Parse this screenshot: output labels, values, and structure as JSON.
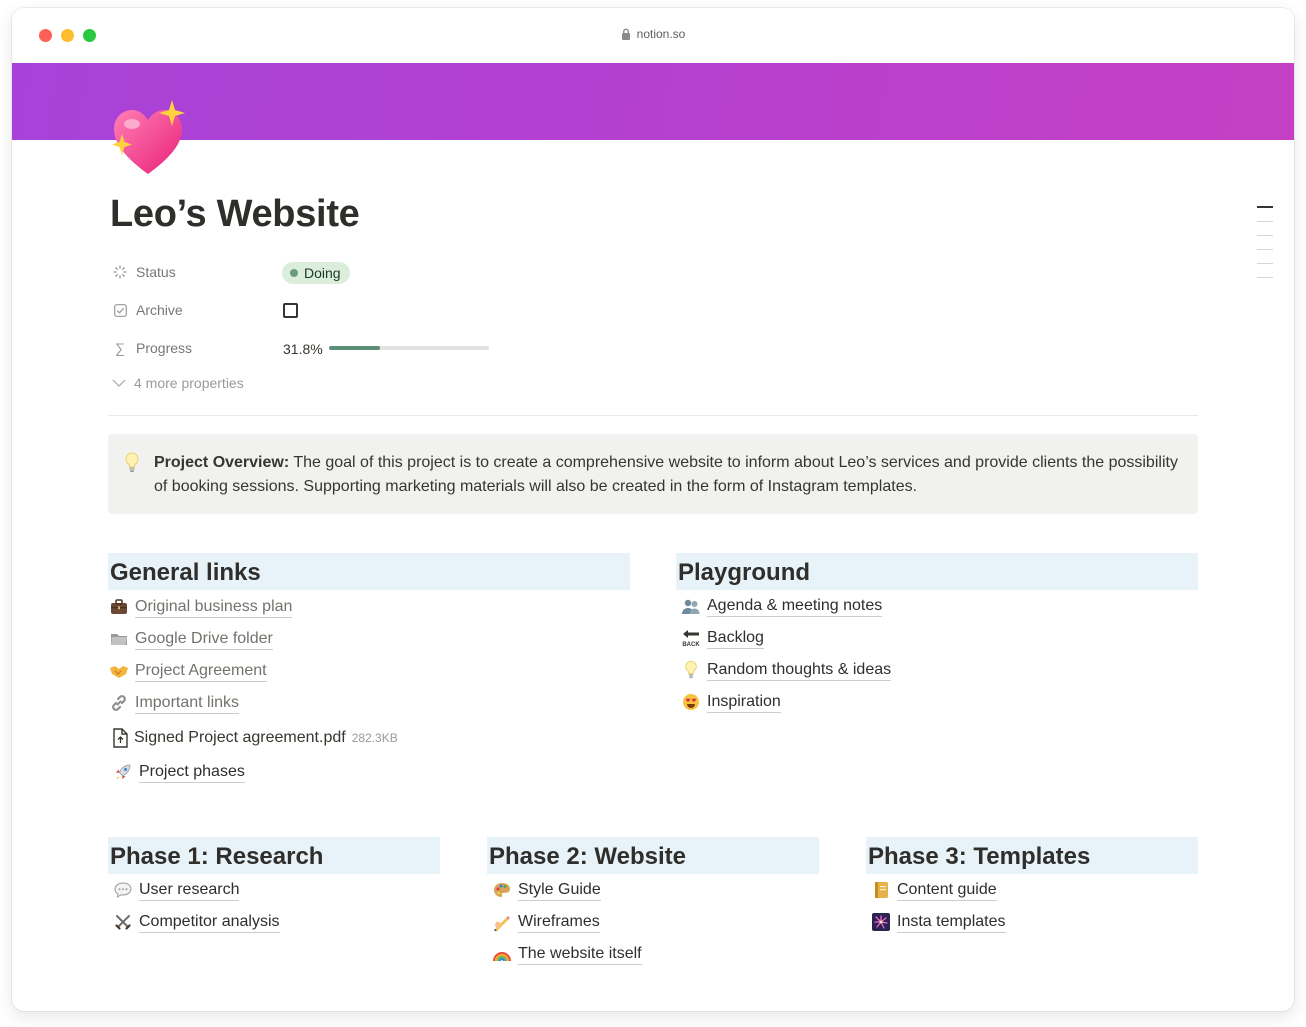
{
  "browser": {
    "url": "notion.so"
  },
  "page": {
    "title": "Leo’s Website",
    "icon": "sparkling-heart-icon"
  },
  "properties": {
    "status": {
      "label": "Status",
      "value": "Doing",
      "color": "#dbeddb"
    },
    "archive": {
      "label": "Archive",
      "checked": false
    },
    "progress": {
      "label": "Progress",
      "value_text": "31.8%",
      "fraction": 0.318
    },
    "more": "4 more properties"
  },
  "callout": {
    "icon": "lightbulb-icon",
    "bold": "Project Overview:",
    "text": " The goal of this project is to create a comprehensive website to inform about Leo’s services and provide clients the possibility of booking sessions. Supporting marketing materials will also be created in the form of Instagram templates."
  },
  "general_links": {
    "heading": "General links",
    "items": [
      {
        "icon": "briefcase-icon",
        "label": "Original business plan"
      },
      {
        "icon": "folder-icon",
        "label": "Google Drive folder"
      },
      {
        "icon": "handshake-icon",
        "label": "Project Agreement"
      },
      {
        "icon": "link-icon",
        "label": "Important links"
      },
      {
        "icon": "file-icon",
        "label": "Signed Project agreement.pdf",
        "size": "282.3KB"
      },
      {
        "icon": "rocket-icon",
        "label": "Project phases"
      }
    ]
  },
  "playground": {
    "heading": "Playground",
    "items": [
      {
        "icon": "people-icon",
        "label": "Agenda & meeting notes"
      },
      {
        "icon": "back-arrow-icon",
        "label": "Backlog"
      },
      {
        "icon": "lightbulb-icon",
        "label": "Random thoughts & ideas"
      },
      {
        "icon": "heart-eyes-icon",
        "label": "Inspiration"
      }
    ]
  },
  "phases": [
    {
      "heading": "Phase 1: Research",
      "items": [
        {
          "icon": "speech-bubble-icon",
          "label": "User research"
        },
        {
          "icon": "crossed-swords-icon",
          "label": "Competitor analysis"
        }
      ]
    },
    {
      "heading": "Phase 2: Website",
      "items": [
        {
          "icon": "palette-icon",
          "label": "Style Guide"
        },
        {
          "icon": "writing-hand-icon",
          "label": "Wireframes"
        },
        {
          "icon": "rainbow-icon",
          "label": "The website itself"
        }
      ]
    },
    {
      "heading": "Phase 3: Templates",
      "items": [
        {
          "icon": "notebook-icon",
          "label": "Content guide"
        },
        {
          "icon": "fireworks-icon",
          "label": "Insta templates"
        }
      ]
    }
  ],
  "colors": {
    "cover_gradient_start": "#a742d8",
    "cover_gradient_end": "#c540c4",
    "heading_background": "#e7f3f8",
    "callout_background": "#f1f1ef",
    "progress_fill": "#5b8f77"
  }
}
